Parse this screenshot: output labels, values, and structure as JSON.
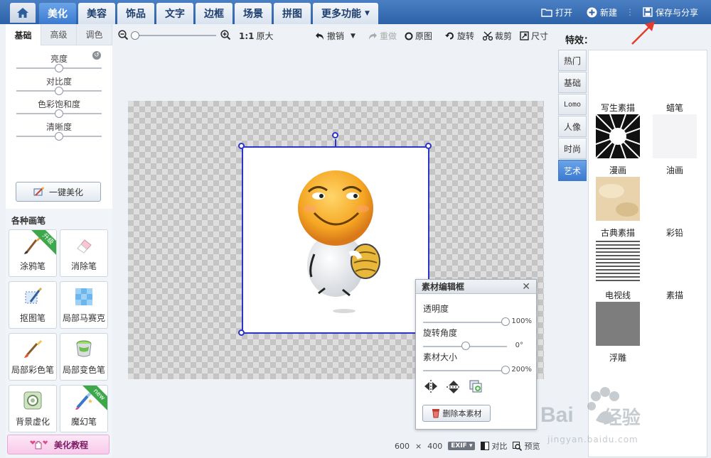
{
  "topbar": {
    "tabs": [
      {
        "label": "美化",
        "active": true
      },
      {
        "label": "美容",
        "active": false
      },
      {
        "label": "饰品",
        "active": false
      },
      {
        "label": "文字",
        "active": false
      },
      {
        "label": "边框",
        "active": false
      },
      {
        "label": "场景",
        "active": false
      },
      {
        "label": "拼图",
        "active": false
      },
      {
        "label": "更多功能",
        "active": false
      }
    ],
    "open_label": "打开",
    "new_label": "新建",
    "save_share_label": "保存与分享"
  },
  "left": {
    "subtabs": [
      "基础",
      "高级",
      "调色"
    ],
    "adjustments": [
      {
        "label": "亮度",
        "level": 0.5
      },
      {
        "label": "对比度",
        "level": 0.5
      },
      {
        "label": "色彩饱和度",
        "level": 0.5
      },
      {
        "label": "清晰度",
        "level": 0.5
      }
    ],
    "one_key_label": "一键美化",
    "brush_title": "各种画笔",
    "brushes": [
      {
        "label": "涂鸦笔",
        "badge": "升级"
      },
      {
        "label": "消除笔",
        "badge": ""
      },
      {
        "label": "抠图笔",
        "badge": ""
      },
      {
        "label": "局部马赛克",
        "badge": ""
      },
      {
        "label": "局部彩色笔",
        "badge": ""
      },
      {
        "label": "局部变色笔",
        "badge": ""
      },
      {
        "label": "背景虚化",
        "badge": ""
      },
      {
        "label": "魔幻笔",
        "badge": "new"
      }
    ],
    "tutorial_label": "美化教程"
  },
  "toolbar": {
    "ratio_label": "1:1",
    "original_size_label": "原大",
    "undo_label": "撤销",
    "redo_label": "重做",
    "original_label": "原图",
    "rotate_label": "旋转",
    "crop_label": "裁剪",
    "size_label": "尺寸"
  },
  "status": {
    "width": "600",
    "times": "×",
    "height": "400",
    "exif_label": "EXIF",
    "compare_label": "对比",
    "preview_label": "预览"
  },
  "dialog": {
    "title": "素材编辑框",
    "opacity_label": "透明度",
    "opacity_value": "100%",
    "rotation_label": "旋转角度",
    "rotation_value": "0°",
    "size_label": "素材大小",
    "size_value": "200%",
    "delete_label": "删除本素材"
  },
  "right": {
    "title": "特效：",
    "categories": [
      {
        "label": "热门",
        "active": false
      },
      {
        "label": "基础",
        "active": false
      },
      {
        "label": "Lomo",
        "active": false
      },
      {
        "label": "人像",
        "active": false
      },
      {
        "label": "时尚",
        "active": false
      },
      {
        "label": "艺术",
        "active": true
      }
    ],
    "effects": [
      {
        "label": "写生素描"
      },
      {
        "label": "蜡笔"
      },
      {
        "label": "漫画"
      },
      {
        "label": "油画"
      },
      {
        "label": "古典素描"
      },
      {
        "label": "彩铅"
      },
      {
        "label": "电视线"
      },
      {
        "label": "素描"
      },
      {
        "label": "浮雕"
      }
    ]
  },
  "colors": {
    "topbar": "#2d62a8",
    "accent": "#3b7ad0",
    "selection": "#2a34c8"
  },
  "watermark": {
    "brand": "Bai",
    "brand_suffix": "经验",
    "url": "jingyan.baidu.com"
  }
}
